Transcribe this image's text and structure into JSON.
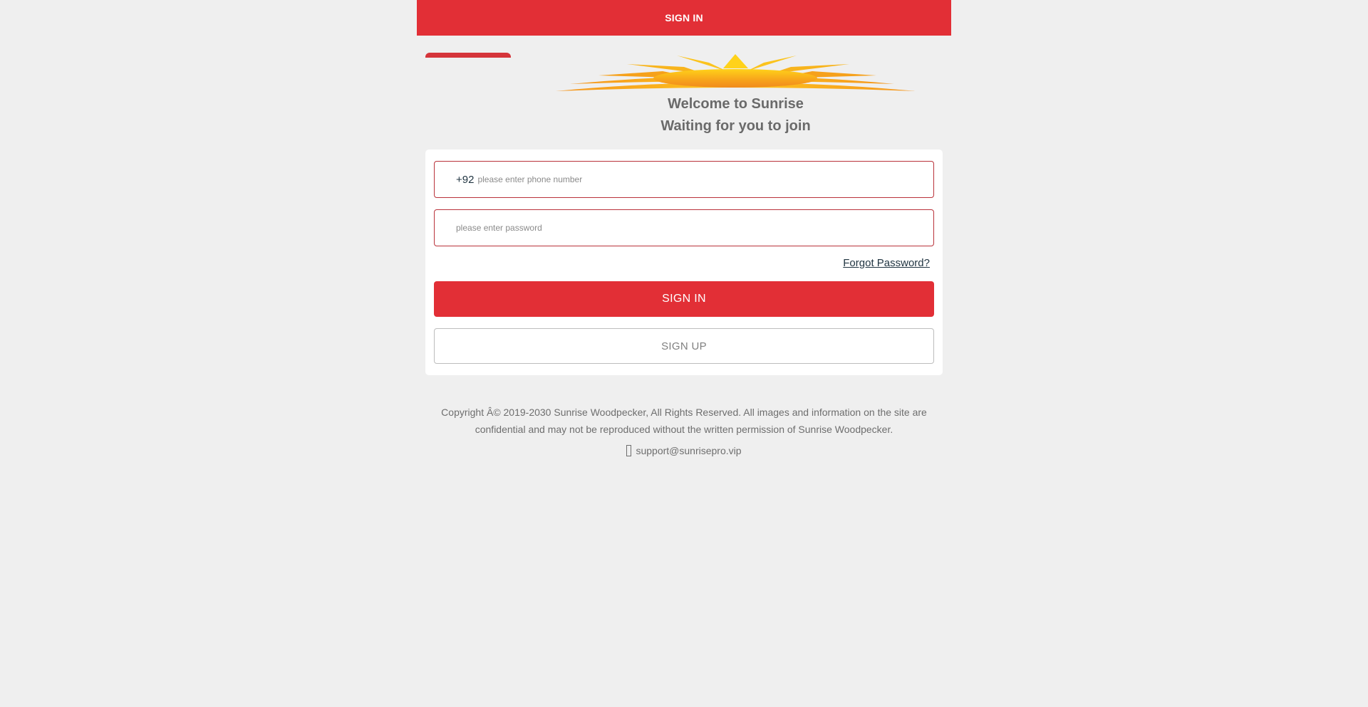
{
  "header": {
    "title": "SIGN IN"
  },
  "welcome": {
    "line1": "Welcome to Sunrise",
    "line2": "Waiting for you to join"
  },
  "form": {
    "country_code": "+92",
    "phone_placeholder": "please enter phone number",
    "password_placeholder": "please enter password",
    "forgot_label": "Forgot Password?",
    "signin_label": "SIGN IN",
    "signup_label": "SIGN UP"
  },
  "footer": {
    "copyright": "Copyright Â© 2019-2030 Sunrise Woodpecker, All Rights Reserved. All images and information on the site are confidential and may not be reproduced without the written permission of Sunrise Woodpecker.",
    "support_email": "support@sunrisepro.vip",
    "support_icon": "mail-icon"
  },
  "colors": {
    "primary": "#e22f36",
    "field_border": "#b9323a",
    "background": "#efefef"
  }
}
